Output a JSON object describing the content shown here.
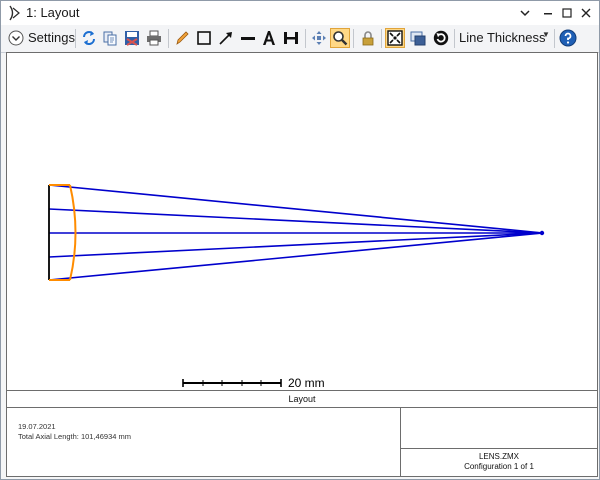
{
  "window": {
    "title": "1: Layout"
  },
  "toolbar": {
    "settings_label": "Settings",
    "line_thickness_label": "Line Thickness",
    "icons": [
      "settings-chevron-icon",
      "refresh-icon",
      "copy-icon",
      "save-icon",
      "print-icon",
      "pencil-icon",
      "rectangle-icon",
      "arrow-icon",
      "line-icon",
      "text-icon",
      "dimension-icon",
      "pan-icon",
      "zoom-icon",
      "lock-icon",
      "fit-icon",
      "windows-icon",
      "rotate-icon",
      "help-icon"
    ],
    "active_tools": [
      "zoom-icon",
      "fit-icon"
    ]
  },
  "plot": {
    "scale_bar_label": "20 mm",
    "colors": {
      "rays": "#0000cc",
      "lens": "#ff8c00",
      "lens_edge": "#000000"
    }
  },
  "footer": {
    "title": "Layout",
    "date": "19.07.2021",
    "axial_length": "Total Axial Length:  101,46934 mm",
    "file_name": "LENS.ZMX",
    "configuration": "Configuration 1 of 1"
  }
}
